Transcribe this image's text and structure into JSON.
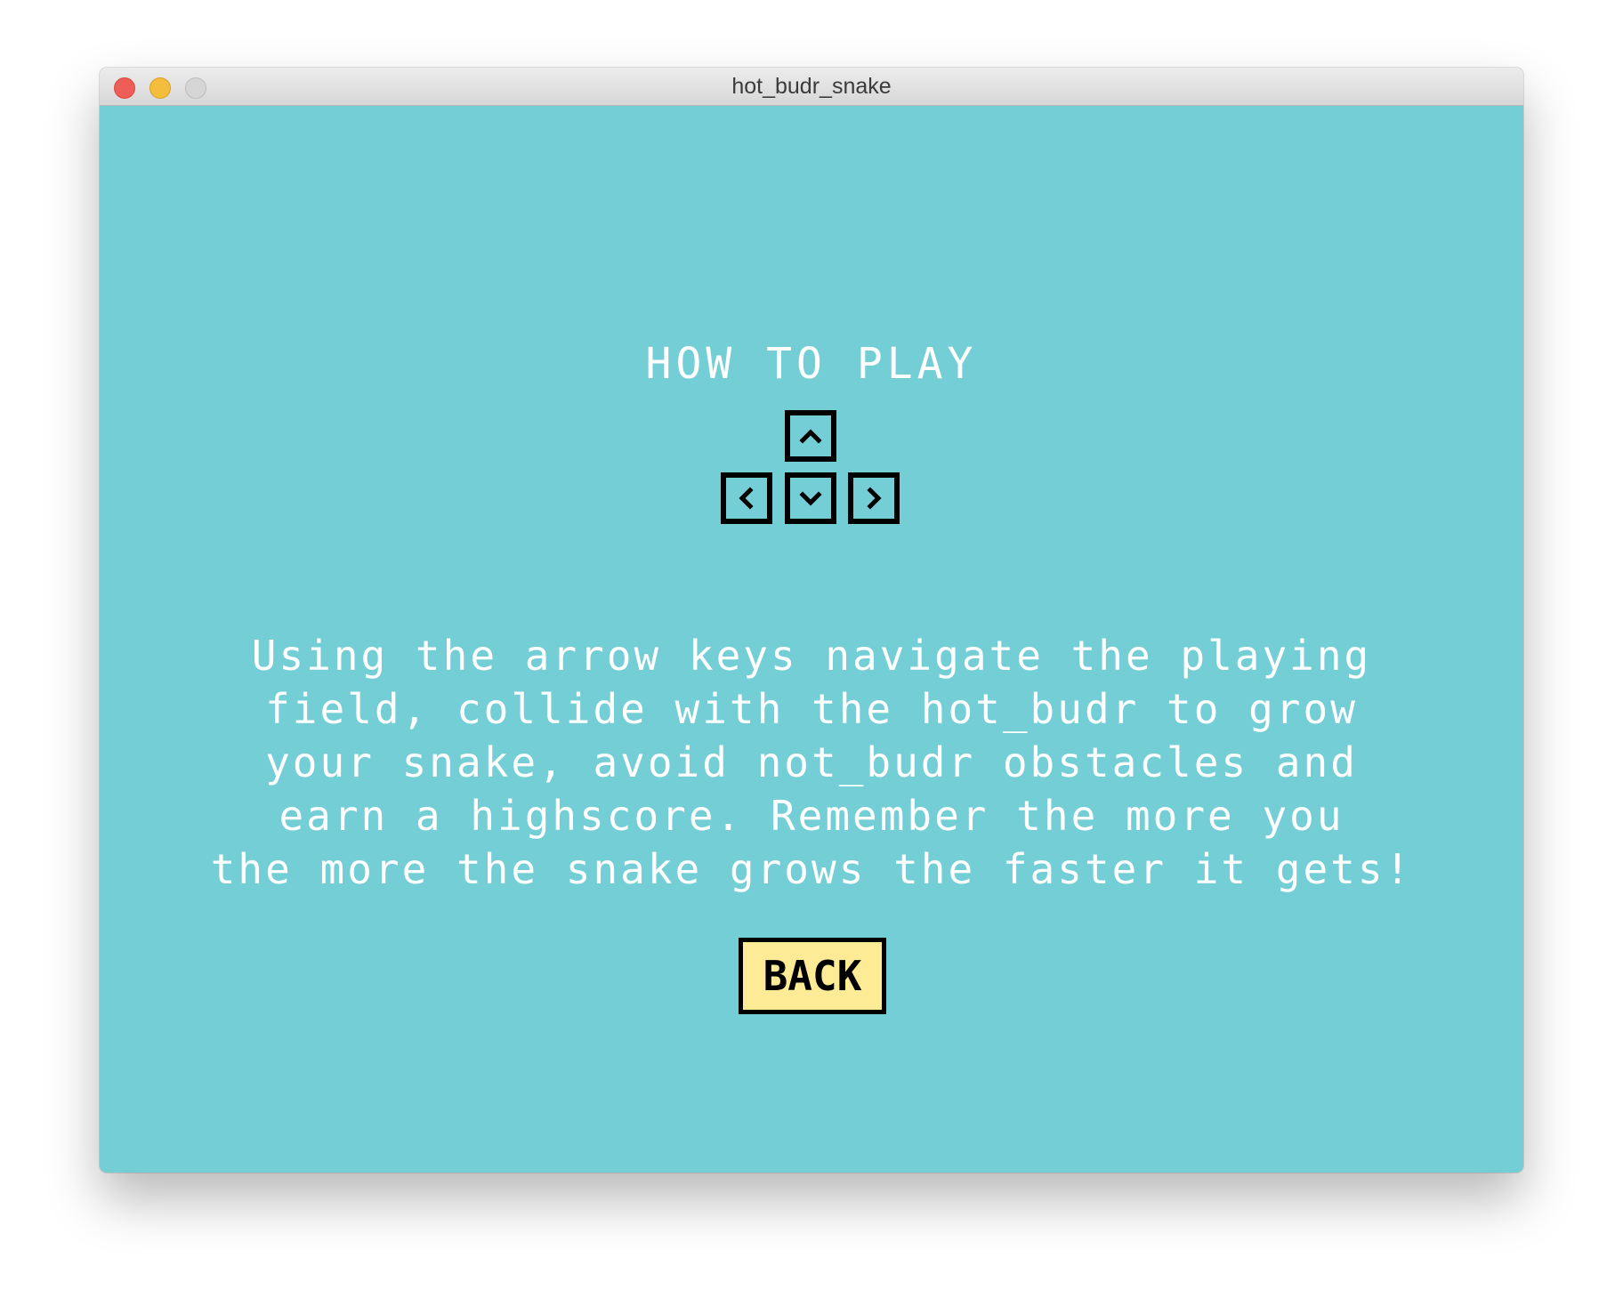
{
  "window": {
    "title": "hot_budr_snake"
  },
  "screen": {
    "heading": "HOW TO PLAY",
    "instructions": [
      "Using the arrow keys navigate the playing",
      "field, collide with the hot_budr to grow",
      "your snake, avoid not_budr obstacles and",
      "earn a highscore. Remember the more you",
      "the more the snake grows the faster it gets!"
    ],
    "back_label": "BACK",
    "keys": [
      "up-arrow-key",
      "left-arrow-key",
      "down-arrow-key",
      "right-arrow-key"
    ]
  },
  "colors": {
    "background": "#74ced5",
    "text": "#ffffff",
    "button_fill": "#fdeb96",
    "outline": "#000000"
  }
}
